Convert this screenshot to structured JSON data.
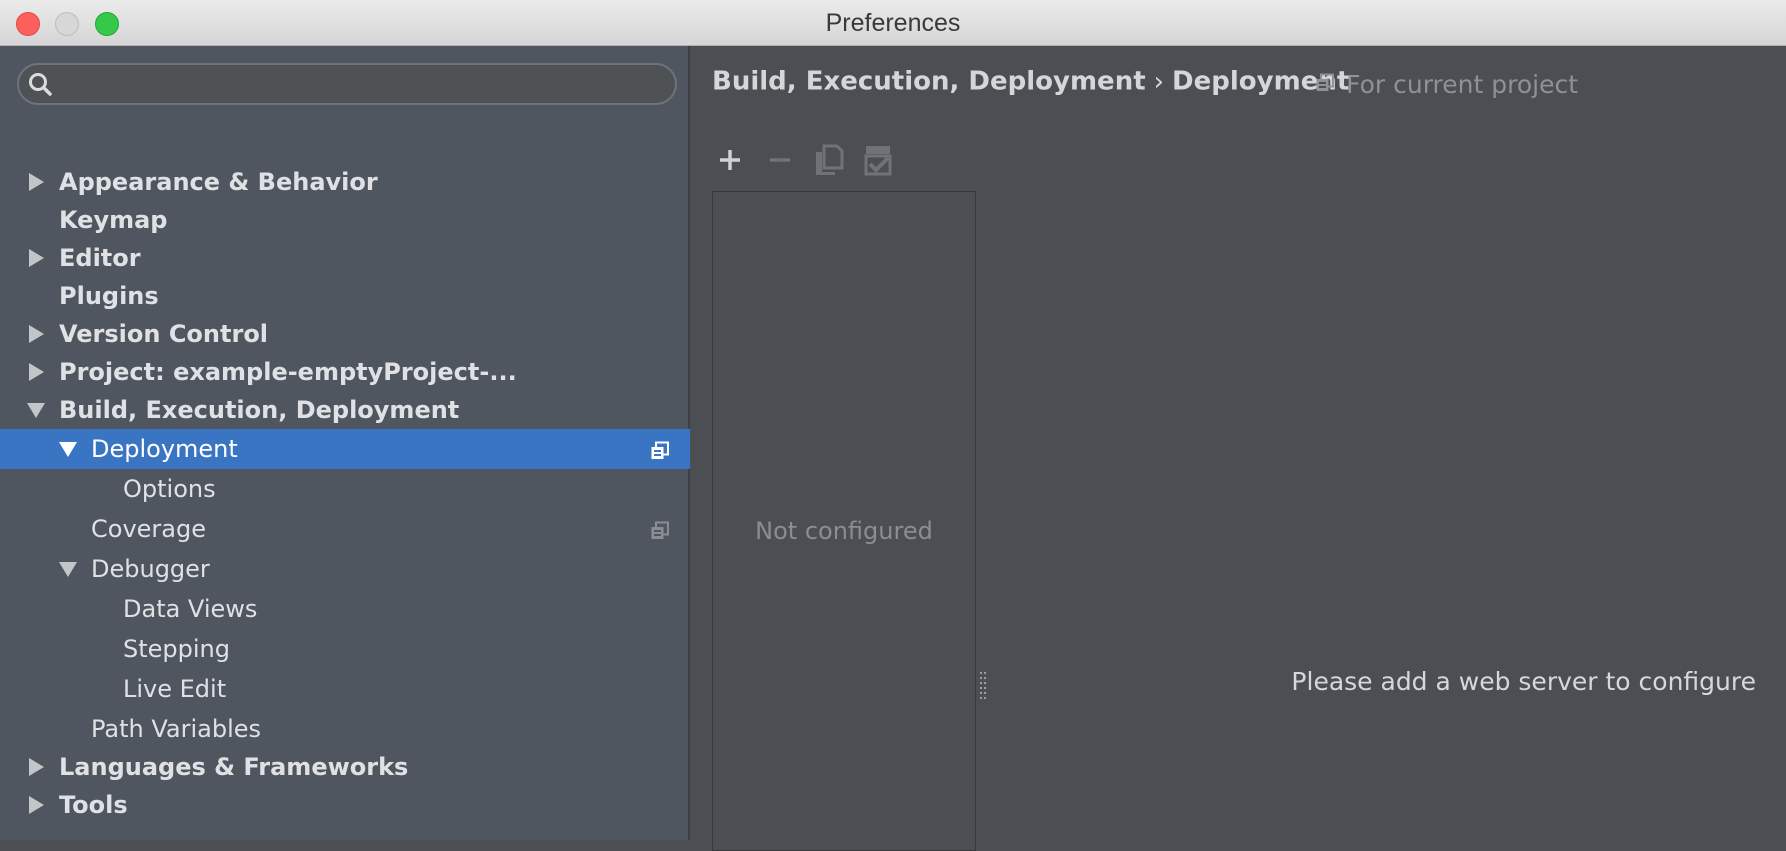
{
  "window": {
    "title": "Preferences"
  },
  "search": {
    "placeholder": "",
    "value": ""
  },
  "tree": [
    {
      "label": "Appearance & Behavior",
      "bold": true,
      "level": 0,
      "arrow": "right"
    },
    {
      "label": "Keymap",
      "bold": true,
      "level": 0,
      "arrow": "none"
    },
    {
      "label": "Editor",
      "bold": true,
      "level": 0,
      "arrow": "right"
    },
    {
      "label": "Plugins",
      "bold": true,
      "level": 0,
      "arrow": "none"
    },
    {
      "label": "Version Control",
      "bold": true,
      "level": 0,
      "arrow": "right"
    },
    {
      "label": "Project: example-emptyProject-...",
      "bold": true,
      "level": 0,
      "arrow": "right"
    },
    {
      "label": "Build, Execution, Deployment",
      "bold": true,
      "level": 0,
      "arrow": "down"
    },
    {
      "label": "Deployment",
      "bold": false,
      "level": 1,
      "arrow": "down",
      "selected": true,
      "project_icon": true
    },
    {
      "label": "Options",
      "bold": false,
      "level": 2,
      "arrow": "none"
    },
    {
      "label": "Coverage",
      "bold": false,
      "level": 1,
      "arrow": "none",
      "project_icon": true
    },
    {
      "label": "Debugger",
      "bold": false,
      "level": 1,
      "arrow": "down"
    },
    {
      "label": "Data Views",
      "bold": false,
      "level": 2,
      "arrow": "none"
    },
    {
      "label": "Stepping",
      "bold": false,
      "level": 2,
      "arrow": "none"
    },
    {
      "label": "Live Edit",
      "bold": false,
      "level": 2,
      "arrow": "none"
    },
    {
      "label": "Path Variables",
      "bold": false,
      "level": 1,
      "arrow": "none"
    },
    {
      "label": "Languages & Frameworks",
      "bold": true,
      "level": 0,
      "arrow": "right"
    },
    {
      "label": "Tools",
      "bold": true,
      "level": 0,
      "arrow": "right"
    }
  ],
  "main": {
    "breadcrumb": {
      "parent": "Build, Execution, Deployment",
      "separator": "›",
      "current": "Deployment"
    },
    "scope_label": "For current project",
    "toolbar": [
      {
        "name": "add-icon"
      },
      {
        "name": "remove-icon"
      },
      {
        "name": "copy-icon"
      },
      {
        "name": "use-as-default-icon"
      }
    ],
    "server_list_empty": "Not configured",
    "hint": "Please add a web server to configure"
  },
  "colors": {
    "sidebar_bg": "#50565f",
    "main_bg": "#4b4e52",
    "selection": "#3a75c4",
    "text": "#dfe1e5",
    "muted_text": "#8e9196"
  }
}
